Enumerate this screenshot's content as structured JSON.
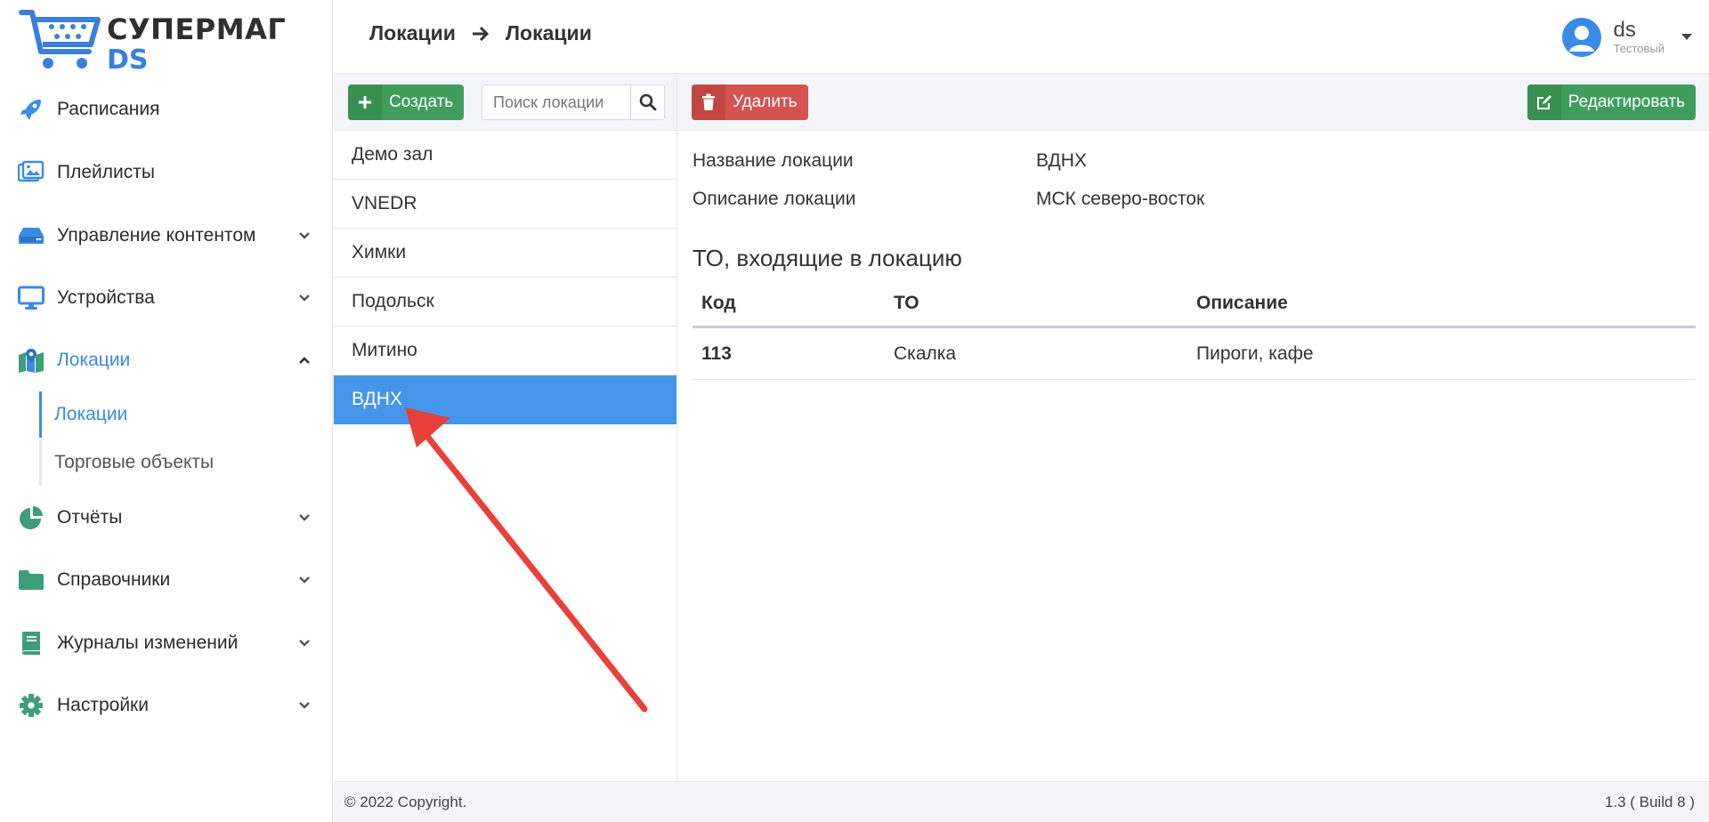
{
  "app": {
    "logo_line1": "СУПЕРМАГ",
    "logo_line2": "DS"
  },
  "sidebar": {
    "items": [
      {
        "label": "Расписания",
        "icon": "rocket-icon",
        "has_chevron": false
      },
      {
        "label": "Плейлисты",
        "icon": "images-icon",
        "has_chevron": false
      },
      {
        "label": "Управление контентом",
        "icon": "drive-icon",
        "has_chevron": true
      },
      {
        "label": "Устройства",
        "icon": "monitor-icon",
        "has_chevron": true
      },
      {
        "label": "Локации",
        "icon": "map-icon",
        "has_chevron": true,
        "expanded": true,
        "active": true
      },
      {
        "label": "Отчёты",
        "icon": "pie-chart-icon",
        "has_chevron": true
      },
      {
        "label": "Справочники",
        "icon": "folder-icon",
        "has_chevron": true
      },
      {
        "label": "Журналы изменений",
        "icon": "book-icon",
        "has_chevron": true
      },
      {
        "label": "Настройки",
        "icon": "gear-icon",
        "has_chevron": true
      }
    ],
    "sub_items": [
      {
        "label": "Локации",
        "active": true
      },
      {
        "label": "Торговые объекты",
        "active": false
      }
    ]
  },
  "header": {
    "breadcrumb": [
      "Локации",
      "Локации"
    ],
    "user_name": "ds",
    "user_role": "Тестовый"
  },
  "list_panel": {
    "create_label": "Создать",
    "search_placeholder": "Поиск локации",
    "items": [
      "Демо зал",
      "VNEDR",
      "Химки",
      "Подольск",
      "Митино",
      "ВДНХ"
    ],
    "selected": "ВДНХ"
  },
  "detail": {
    "delete_label": "Удалить",
    "edit_label": "Редактировать",
    "name_label": "Название локации",
    "name_value": "ВДНХ",
    "desc_label": "Описание локации",
    "desc_value": "МСК северо-восток",
    "section_title": "ТО, входящие в локацию",
    "table": {
      "headers": [
        "Код",
        "ТО",
        "Описание"
      ],
      "rows": [
        [
          "113",
          "Скалка",
          "Пироги, кафе"
        ]
      ]
    }
  },
  "footer": {
    "copyright": "© 2022 Copyright.",
    "version": "1.3 ( Build 8 )"
  },
  "colors": {
    "accent": "#3a8be6",
    "selected_row": "#4596ea",
    "icon_green": "#3f9e7a",
    "btn_green": "#3f9e5c",
    "btn_red": "#d45350",
    "annotation_arrow": "#e8403a"
  }
}
